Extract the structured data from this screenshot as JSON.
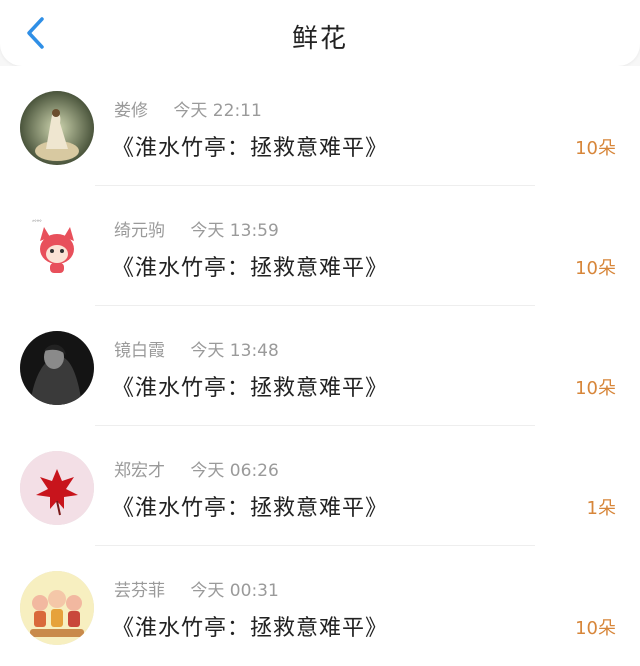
{
  "header": {
    "title": "鲜花",
    "back_icon": "chevron-left-icon",
    "accent_color": "#2f8fe6"
  },
  "items": [
    {
      "name": "娄修",
      "time": "今天 22:11",
      "message": "《淮水竹亭：拯救意难平》",
      "count": "10朵"
    },
    {
      "name": "绮元驹",
      "time": "今天 13:59",
      "message": "《淮水竹亭：拯救意难平》",
      "count": "10朵"
    },
    {
      "name": "镜白霞",
      "time": "今天 13:48",
      "message": "《淮水竹亭：拯救意难平》",
      "count": "10朵"
    },
    {
      "name": "郑宏才",
      "time": "今天 06:26",
      "message": "《淮水竹亭：拯救意难平》",
      "count": "1朵"
    },
    {
      "name": "芸芬菲",
      "time": "今天 00:31",
      "message": "《淮水竹亭：拯救意难平》",
      "count": "10朵"
    }
  ],
  "colors": {
    "count": "#d7863a",
    "meta": "#9a9a9a"
  }
}
